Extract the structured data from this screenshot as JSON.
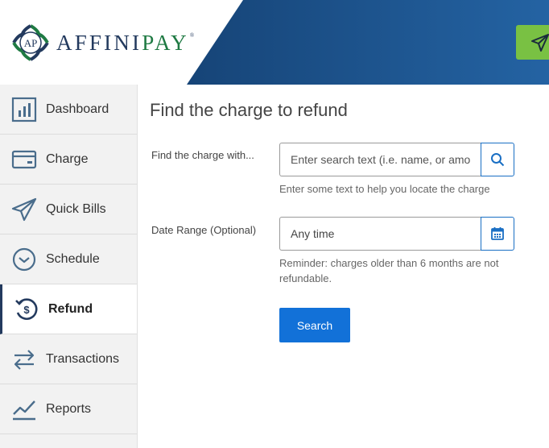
{
  "brand": {
    "prefix": "AFFINI",
    "suffix": "PAY",
    "registered": "®",
    "monogram": "AP"
  },
  "colors": {
    "navy": "#233a5e",
    "header_blue": "#1c4f86",
    "green": "#79c143",
    "primary_button": "#1271d8",
    "sidebar_bg": "#f2f2f2"
  },
  "sidebar": {
    "items": [
      {
        "label": "Dashboard",
        "icon": "bar-chart-icon"
      },
      {
        "label": "Charge",
        "icon": "credit-card-icon"
      },
      {
        "label": "Quick Bills",
        "icon": "paper-plane-icon"
      },
      {
        "label": "Schedule",
        "icon": "clock-icon"
      },
      {
        "label": "Refund",
        "icon": "refund-dollar-icon",
        "active": true
      },
      {
        "label": "Transactions",
        "icon": "arrows-exchange-icon"
      },
      {
        "label": "Reports",
        "icon": "line-chart-icon"
      }
    ]
  },
  "main": {
    "title": "Find the charge to refund",
    "search": {
      "label": "Find the charge with...",
      "placeholder": "Enter search text (i.e. name, or amount)",
      "help": "Enter some text to help you locate the charge"
    },
    "date_range": {
      "label": "Date Range (Optional)",
      "value": "Any time",
      "help": "Reminder: charges older than 6 months are not refundable."
    },
    "search_button": "Search"
  }
}
